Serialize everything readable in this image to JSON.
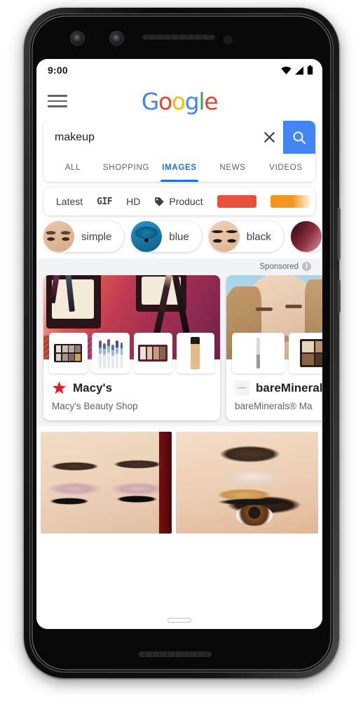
{
  "device": {
    "name": "pixel-3-phone-mockup",
    "frame_color": "#1d1d1f"
  },
  "status_bar": {
    "time": "9:00",
    "icons": [
      "wifi-icon",
      "cellular-signal-icon",
      "battery-icon"
    ]
  },
  "header": {
    "menu_icon": "hamburger-menu-icon",
    "logo": {
      "letters": [
        {
          "char": "G",
          "color": "#4285F4"
        },
        {
          "char": "o",
          "color": "#EA4335"
        },
        {
          "char": "o",
          "color": "#FBBC05"
        },
        {
          "char": "g",
          "color": "#4285F4"
        },
        {
          "char": "l",
          "color": "#34A853"
        },
        {
          "char": "e",
          "color": "#EA4335"
        }
      ],
      "text": "Google"
    }
  },
  "search": {
    "value": "makeup",
    "placeholder": "Search",
    "clear_icon": "close-x-icon",
    "submit_icon": "search-magnifier-icon",
    "submit_color": "#4285F4"
  },
  "tabs": [
    {
      "label": "ALL",
      "active": false
    },
    {
      "label": "SHOPPING",
      "active": false
    },
    {
      "label": "IMAGES",
      "active": true
    },
    {
      "label": "NEWS",
      "active": false
    },
    {
      "label": "VIDEOS",
      "active": false
    }
  ],
  "tab_accent_color": "#1a73e8",
  "filters": [
    {
      "type": "text",
      "label": "Latest"
    },
    {
      "type": "gif",
      "label": "GIF"
    },
    {
      "type": "text",
      "label": "HD"
    },
    {
      "type": "tag",
      "label": "Product",
      "icon": "tag-icon"
    },
    {
      "type": "color",
      "label": "red",
      "color": "#E8503A"
    },
    {
      "type": "color",
      "label": "orange",
      "color": "#F3961D"
    }
  ],
  "suggestions": [
    {
      "label": "simple",
      "thumb": "eyes-brown-tones"
    },
    {
      "label": "blue",
      "thumb": "blue-eyeshadow-eye"
    },
    {
      "label": "black",
      "thumb": "black-smokey-eyes"
    },
    {
      "label": "",
      "thumb": "dark-red-lipstick"
    }
  ],
  "sponsored": {
    "label": "Sponsored",
    "info_icon": "info-icon",
    "info_glyph": "i"
  },
  "ads": [
    {
      "brand": "Macy's",
      "subtitle": "Macy's Beauty Shop",
      "logo_icon": "macys-star-icon",
      "logo_color": "#E21A2C",
      "thumbnails": [
        "eyeshadow-palette",
        "makeup-brush-set",
        "neutral-palette",
        "foundation-bottle"
      ]
    },
    {
      "brand": "bareMinerals",
      "subtitle": "bareMinerals® Ma",
      "logo_icon": "bareminerals-dash-icon",
      "logo_color": "#8a8a8a",
      "thumbnails": [
        "mascara-wand",
        "bronzer-quad-palette"
      ]
    }
  ],
  "image_results": [
    {
      "alt": "closed-eyes-shimmer-eyeshadow-winged-liner"
    },
    {
      "alt": "brown-smokey-eye-bold-brow"
    }
  ],
  "nav": {
    "gesture_pill": "home-gesture-pill"
  }
}
